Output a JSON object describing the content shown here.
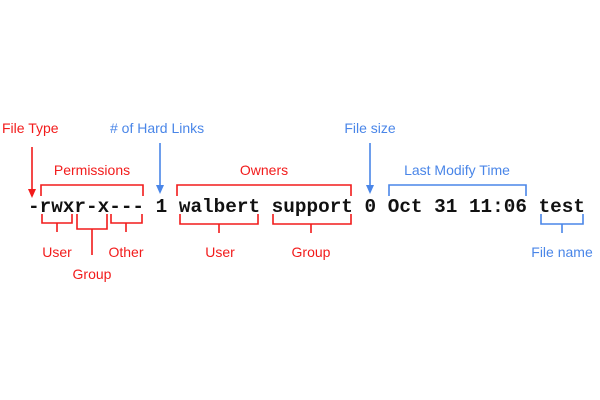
{
  "command": "-rwxr-x--- 1 walbert support 0 Oct 31 11:06 test",
  "labels": {
    "file_type": "File Type",
    "hard_links": "# of Hard Links",
    "file_size": "File size",
    "permissions": "Permissions",
    "owners": "Owners",
    "last_modify_time": "Last Modify Time",
    "perm_user": "User",
    "perm_group": "Group",
    "perm_other": "Other",
    "owner_user": "User",
    "owner_group": "Group",
    "file_name": "File name"
  },
  "colors": {
    "red": "#f21b1b",
    "blue": "#4a86e8",
    "text": "#111111"
  }
}
